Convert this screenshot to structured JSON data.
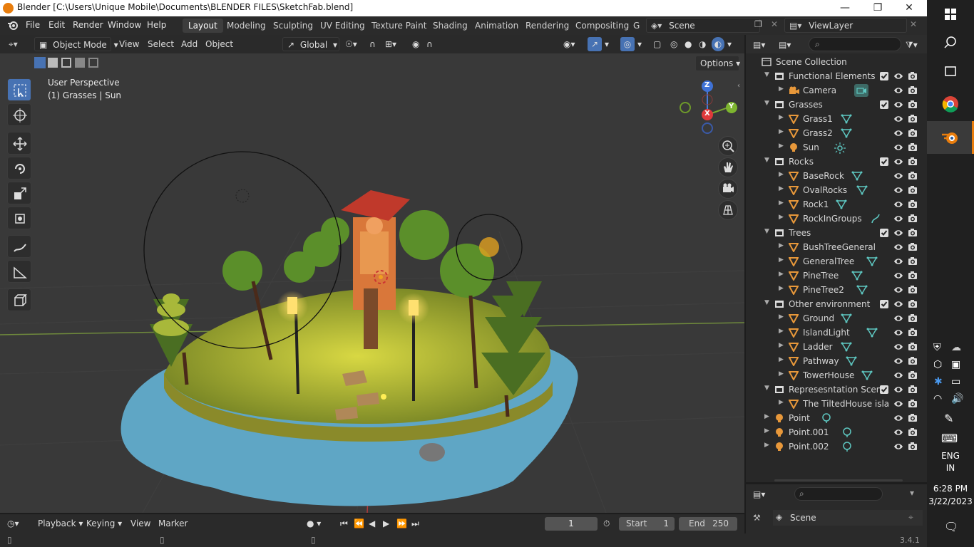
{
  "titlebar": {
    "title": "Blender [C:\\Users\\Unique Mobile\\Documents\\BLENDER FILES\\SketchFab.blend]"
  },
  "menu": {
    "file": "File",
    "edit": "Edit",
    "render": "Render",
    "window": "Window",
    "help": "Help"
  },
  "workspaces": [
    "Layout",
    "Modeling",
    "Sculpting",
    "UV Editing",
    "Texture Paint",
    "Shading",
    "Animation",
    "Rendering",
    "Compositing",
    "G"
  ],
  "scene_selector": "Scene",
  "viewlayer_selector": "ViewLayer",
  "viewport_header": {
    "mode": "Object Mode",
    "view": "View",
    "select": "Select",
    "add": "Add",
    "object": "Object",
    "transform": "Global"
  },
  "viewport": {
    "perspective": "User Perspective",
    "selection": "(1) Grasses | Sun",
    "options": "Options",
    "gizmo_z": "Z",
    "gizmo_y": "Y",
    "gizmo_x": "X"
  },
  "outliner": {
    "rows": [
      {
        "name": "Scene Collection"
      },
      {
        "name": "Functional Elements"
      },
      {
        "name": "Camera"
      },
      {
        "name": "Grasses"
      },
      {
        "name": "Grass1"
      },
      {
        "name": "Grass2"
      },
      {
        "name": "Sun"
      },
      {
        "name": "Rocks"
      },
      {
        "name": "BaseRock"
      },
      {
        "name": "OvalRocks"
      },
      {
        "name": "Rock1"
      },
      {
        "name": "RockInGroups"
      },
      {
        "name": "Trees"
      },
      {
        "name": "BushTreeGeneral"
      },
      {
        "name": "GeneralTree"
      },
      {
        "name": "PineTree"
      },
      {
        "name": "PineTree2"
      },
      {
        "name": "Other environment"
      },
      {
        "name": "Ground"
      },
      {
        "name": "IslandLight"
      },
      {
        "name": "Ladder"
      },
      {
        "name": "Pathway"
      },
      {
        "name": "TowerHouse"
      },
      {
        "name": "Represesntation Scene"
      },
      {
        "name": "The TiltedHouse isla"
      },
      {
        "name": "Point"
      },
      {
        "name": "Point.001"
      },
      {
        "name": "Point.002"
      }
    ]
  },
  "properties": {
    "scene": "Scene"
  },
  "timeline": {
    "playback": "Playback",
    "keying": "Keying",
    "view": "View",
    "marker": "Marker",
    "current_frame": "1",
    "start_label": "Start",
    "start": "1",
    "end_label": "End",
    "end": "250"
  },
  "statusbar": {
    "version": "3.4.1"
  },
  "taskbar": {
    "lang1": "ENG",
    "lang2": "IN",
    "time": "6:28 PM",
    "date": "3/22/2023"
  },
  "colors": {
    "accent": "#4772b3",
    "orange": "#e87d0d",
    "cyan": "#5ec7c1",
    "panel": "#282828"
  }
}
